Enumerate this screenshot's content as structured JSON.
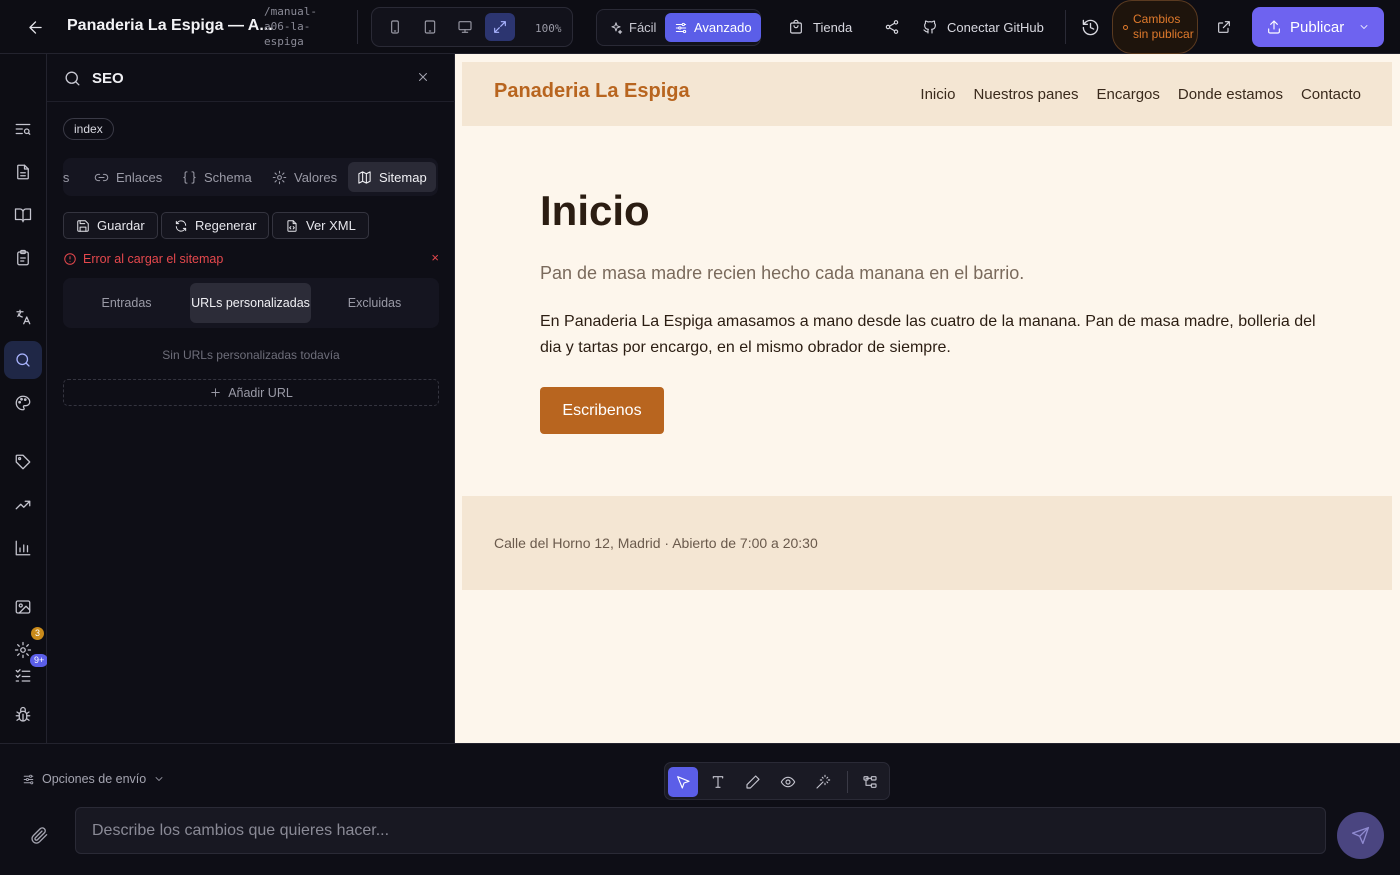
{
  "topbar": {
    "project_title": "Panaderia La Espiga — A...",
    "project_slug": "/manual-a06-la-espiga",
    "zoom": "100%",
    "mode_easy": "Fácil",
    "mode_advanced": "Avanzado",
    "store": "Tienda",
    "connect_github": "Conectar GitHub",
    "unpublished": "Cambios sin publicar",
    "publish": "Publicar"
  },
  "rail": {
    "badge_settings": "3",
    "badge_tasks": "9+"
  },
  "seo_panel": {
    "title": "SEO",
    "page_chip": "index",
    "tabs": [
      "is",
      "Enlaces",
      "Schema",
      "Valores",
      "Sitemap"
    ],
    "active_tab": "Sitemap",
    "actions": {
      "save": "Guardar",
      "regenerate": "Regenerar",
      "view_xml": "Ver XML"
    },
    "error": "Error al cargar el sitemap",
    "error_dismiss": "×",
    "segments": [
      "Entradas",
      "URLs personalizadas",
      "Excluidas"
    ],
    "active_segment": "URLs personalizadas",
    "empty": "Sin URLs personalizadas todavía",
    "add_url": "Añadir URL"
  },
  "preview": {
    "logo": "Panaderia La Espiga",
    "nav": [
      "Inicio",
      "Nuestros panes",
      "Encargos",
      "Donde estamos",
      "Contacto"
    ],
    "title": "Inicio",
    "subtitle": "Pan de masa madre recien hecho cada manana en el barrio.",
    "body": "En Panaderia La Espiga amasamos a mano desde las cuatro de la manana. Pan de masa madre, bolleria del dia y tartas por encargo, en el mismo obrador de siempre.",
    "cta": "Escribenos",
    "footer": "Calle del Horno 12, Madrid · Abierto de 7:00 a 20:30"
  },
  "composer": {
    "send_options": "Opciones de envío",
    "placeholder": "Describe los cambios que quieres hacer..."
  },
  "colors": {
    "accent": "#5b5ee8",
    "publish": "#6e63f0",
    "brand": "#b8651f",
    "error": "#e5484d",
    "warning": "#e07a2c"
  }
}
